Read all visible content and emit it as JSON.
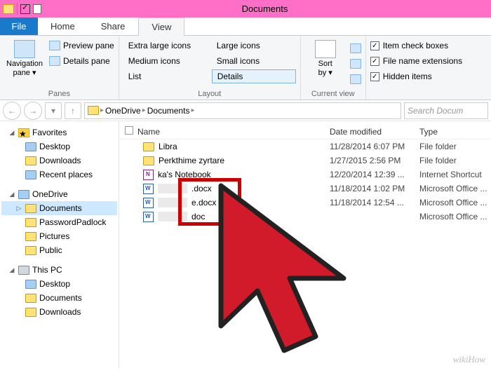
{
  "window": {
    "title": "Documents"
  },
  "tabs": {
    "file": "File",
    "home": "Home",
    "share": "Share",
    "view": "View"
  },
  "ribbon": {
    "panes": {
      "label": "Panes",
      "nav": "Navigation\npane",
      "preview": "Preview pane",
      "details": "Details pane"
    },
    "layout": {
      "label": "Layout",
      "xl": "Extra large icons",
      "large": "Large icons",
      "medium": "Medium icons",
      "small": "Small icons",
      "list": "List",
      "details": "Details"
    },
    "current": {
      "label": "Current view",
      "sort": "Sort\nby"
    },
    "options": {
      "item_check": "Item check boxes",
      "ext": "File name extensions",
      "hidden": "Hidden items"
    }
  },
  "address": {
    "back": "←",
    "fwd": "→",
    "up": "↑",
    "crumbs": [
      "OneDrive",
      "Documents"
    ],
    "search_placeholder": "Search Docum"
  },
  "sidebar": {
    "favorites": "Favorites",
    "fav_items": [
      "Desktop",
      "Downloads",
      "Recent places"
    ],
    "onedrive": "OneDrive",
    "od_items": [
      "Documents",
      "PasswordPadlock",
      "Pictures",
      "Public"
    ],
    "thispc": "This PC",
    "pc_items": [
      "Desktop",
      "Documents",
      "Downloads"
    ]
  },
  "columns": {
    "name": "Name",
    "date": "Date modified",
    "type": "Type"
  },
  "files": [
    {
      "icon": "folder",
      "name": "Libra",
      "date": "11/28/2014 6:07 PM",
      "type": "File folder"
    },
    {
      "icon": "folder",
      "name": "Perkthime zyrtare",
      "date": "1/27/2015 2:56 PM",
      "type": "File folder"
    },
    {
      "icon": "note",
      "name": "ka's Notebook",
      "date": "12/20/2014 12:39 ...",
      "type": "Internet Shortcut"
    },
    {
      "icon": "doc",
      "name": ".docx",
      "date": "11/18/2014 1:02 PM",
      "type": "Microsoft Office ...",
      "red": true
    },
    {
      "icon": "doc",
      "name": "e.docx",
      "date": "11/18/2014 12:54 ...",
      "type": "Microsoft Office ...",
      "red": true
    },
    {
      "icon": "doc",
      "name": "doc",
      "date": "",
      "type": "Microsoft Office ...",
      "red": true
    }
  ],
  "watermark": "wikiHow"
}
